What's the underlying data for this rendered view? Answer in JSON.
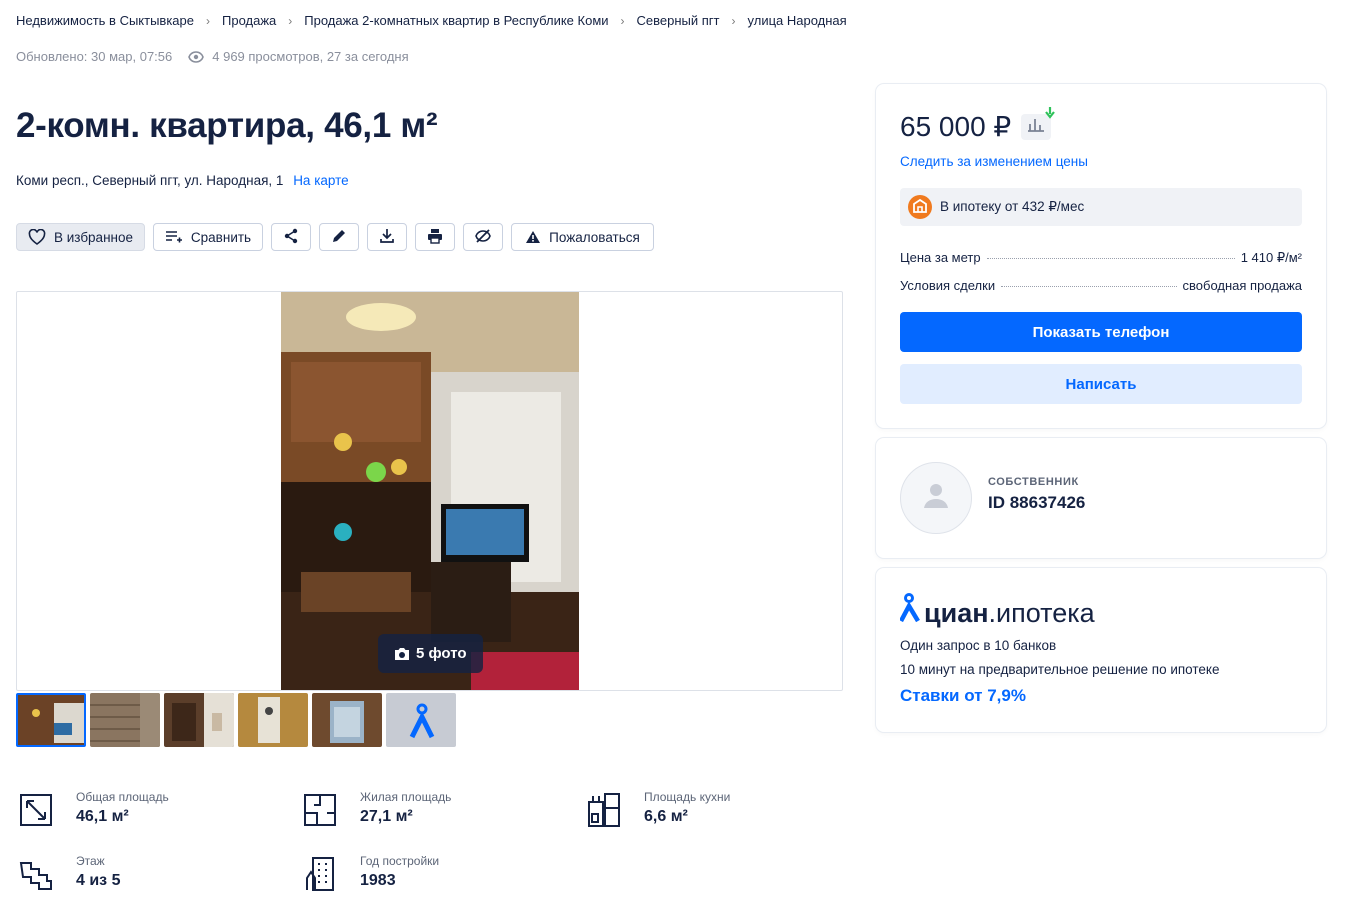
{
  "breadcrumbs": [
    "Недвижимость в Сыктывкаре",
    "Продажа",
    "Продажа 2-комнатных квартир в Республике Коми",
    "Северный пгт",
    "улица Народная"
  ],
  "meta": {
    "updated": "Обновлено: 30 мар, 07:56",
    "views": "4 969 просмотров, 27 за сегодня"
  },
  "title": "2-комн. квартира, 46,1 м²",
  "address": {
    "text": "Коми респ., Северный пгт, ул. Народная, 1",
    "map_link": "На карте"
  },
  "actions": {
    "favorite": "В избранное",
    "compare": "Сравнить",
    "report": "Пожаловаться"
  },
  "gallery": {
    "photo_count_label": "5 фото"
  },
  "facts": [
    {
      "label": "Общая площадь",
      "value": "46,1 м²",
      "icon": "total-area-icon"
    },
    {
      "label": "Жилая площадь",
      "value": "27,1 м²",
      "icon": "living-area-icon"
    },
    {
      "label": "Площадь кухни",
      "value": "6,6 м²",
      "icon": "kitchen-icon"
    },
    {
      "label": "Этаж",
      "value": "4 из 5",
      "icon": "stairs-icon"
    },
    {
      "label": "Год постройки",
      "value": "1983",
      "icon": "building-icon"
    }
  ],
  "price_card": {
    "price": "65 000 ₽",
    "track_price": "Следить за изменением цены",
    "mortgage": "В ипотеку от 432 ₽/мес",
    "price_per_meter_label": "Цена за метр",
    "price_per_meter_value": "1 410 ₽/м²",
    "deal_label": "Условия сделки",
    "deal_value": "свободная продажа",
    "show_phone": "Показать телефон",
    "write": "Написать"
  },
  "owner": {
    "role": "СОБСТВЕННИК",
    "id": "ID 88637426"
  },
  "cian_mortgage": {
    "logo_bold": "циан",
    "logo_reg": ".ипотека",
    "line1": "Один запрос в 10 банков",
    "line2": "10 минут на предварительное решение по ипотеке",
    "rates": "Ставки от 7,9%"
  },
  "colors": {
    "accent": "#0468ff",
    "text": "#152242",
    "muted": "#8a8f9c",
    "price_down": "#2fc25b"
  }
}
